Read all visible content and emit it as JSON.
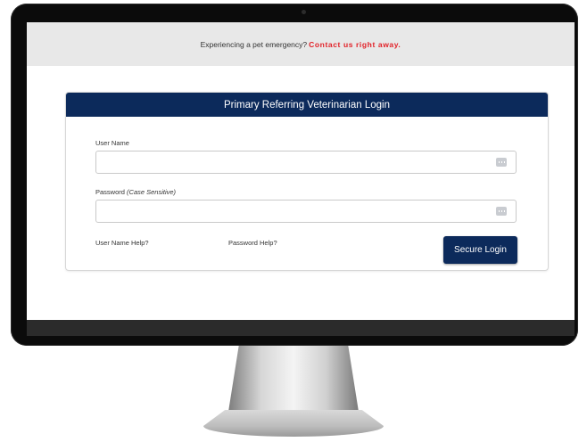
{
  "banner": {
    "emergency_text": "Experiencing a pet emergency?",
    "contact_link": "Contact us right away."
  },
  "login": {
    "title": "Primary Referring Veterinarian Login",
    "username_label": "User Name",
    "username_value": "",
    "password_label": "Password",
    "password_note": "(Case Sensitive)",
    "password_value": "",
    "username_help": "User Name Help?",
    "password_help": "Password Help?",
    "submit_label": "Secure Login"
  },
  "icons": {
    "username_field_icon": "password-manager-key-icon",
    "password_field_icon": "password-manager-key-icon"
  },
  "colors": {
    "header_navy": "#0c2a5b",
    "contact_red": "#e21f26",
    "banner_gray": "#e8e8e8"
  }
}
